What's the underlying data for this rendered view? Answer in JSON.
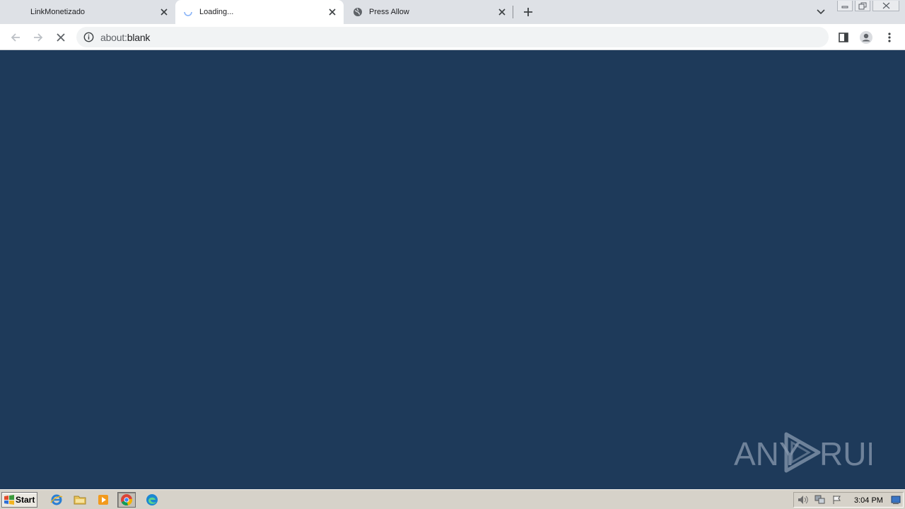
{
  "browser": {
    "tabs": [
      {
        "title": "LinkMonetizado",
        "state": "inactive"
      },
      {
        "title": "Loading...",
        "state": "active"
      },
      {
        "title": "Press Allow",
        "state": "inactive"
      }
    ],
    "address": {
      "scheme": "about:",
      "path": "blank"
    }
  },
  "watermark": {
    "left_text": "ANY",
    "right_text": "RUN"
  },
  "taskbar": {
    "start_label": "Start",
    "clock": "3:04 PM"
  },
  "colors": {
    "page_background": "#1e3a5a",
    "tabstrip": "#dee1e6",
    "taskbar": "#d6d2c9"
  }
}
